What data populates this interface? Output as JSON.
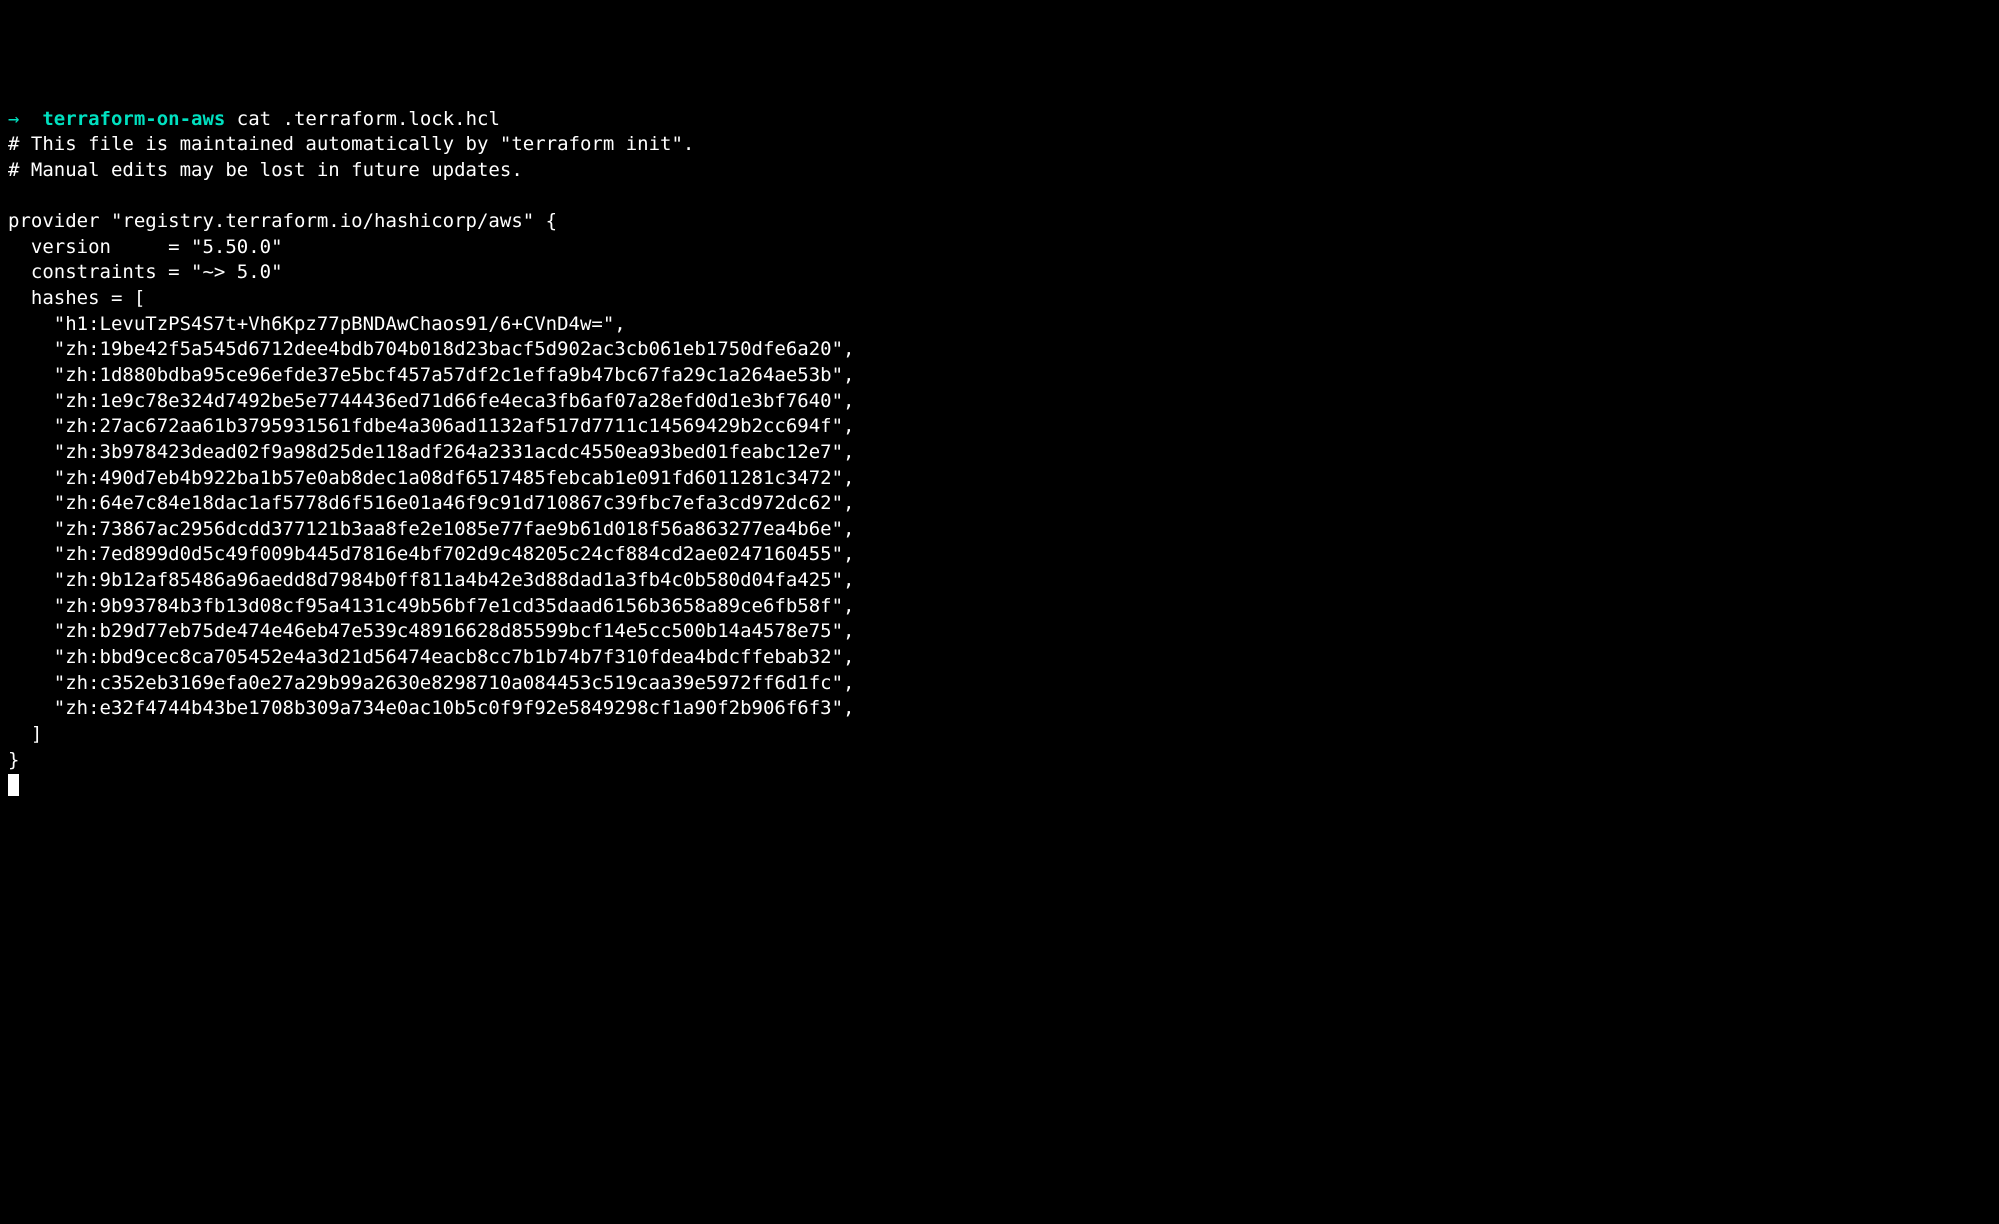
{
  "prompt": {
    "arrow": "→  ",
    "dir": "terraform-on-aws",
    "command": " cat .terraform.lock.hcl"
  },
  "file": {
    "comment1": "# This file is maintained automatically by \"terraform init\".",
    "comment2": "# Manual edits may be lost in future updates.",
    "provider_open": "provider \"registry.terraform.io/hashicorp/aws\" {",
    "version_line": "  version     = \"5.50.0\"",
    "constraints_line": "  constraints = \"~> 5.0\"",
    "hashes_open": "  hashes = [",
    "hashes": [
      "    \"h1:LevuTzPS4S7t+Vh6Kpz77pBNDAwChaos91/6+CVnD4w=\",",
      "    \"zh:19be42f5a545d6712dee4bdb704b018d23bacf5d902ac3cb061eb1750dfe6a20\",",
      "    \"zh:1d880bdba95ce96efde37e5bcf457a57df2c1effa9b47bc67fa29c1a264ae53b\",",
      "    \"zh:1e9c78e324d7492be5e7744436ed71d66fe4eca3fb6af07a28efd0d1e3bf7640\",",
      "    \"zh:27ac672aa61b3795931561fdbe4a306ad1132af517d7711c14569429b2cc694f\",",
      "    \"zh:3b978423dead02f9a98d25de118adf264a2331acdc4550ea93bed01feabc12e7\",",
      "    \"zh:490d7eb4b922ba1b57e0ab8dec1a08df6517485febcab1e091fd6011281c3472\",",
      "    \"zh:64e7c84e18dac1af5778d6f516e01a46f9c91d710867c39fbc7efa3cd972dc62\",",
      "    \"zh:73867ac2956dcdd377121b3aa8fe2e1085e77fae9b61d018f56a863277ea4b6e\",",
      "    \"zh:7ed899d0d5c49f009b445d7816e4bf702d9c48205c24cf884cd2ae0247160455\",",
      "    \"zh:9b12af85486a96aedd8d7984b0ff811a4b42e3d88dad1a3fb4c0b580d04fa425\",",
      "    \"zh:9b93784b3fb13d08cf95a4131c49b56bf7e1cd35daad6156b3658a89ce6fb58f\",",
      "    \"zh:b29d77eb75de474e46eb47e539c48916628d85599bcf14e5cc500b14a4578e75\",",
      "    \"zh:bbd9cec8ca705452e4a3d21d56474eacb8cc7b1b74b7f310fdea4bdcffebab32\",",
      "    \"zh:c352eb3169efa0e27a29b99a2630e8298710a084453c519caa39e5972ff6d1fc\",",
      "    \"zh:e32f4744b43be1708b309a734e0ac10b5c0f9f92e5849298cf1a90f2b906f6f3\","
    ],
    "hashes_close": "  ]",
    "provider_close": "}"
  }
}
